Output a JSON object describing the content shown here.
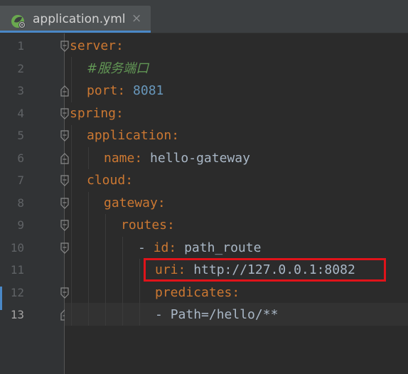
{
  "tab": {
    "title": "application.yml",
    "close_glyph": "×",
    "icon": "spring-leaf-icon"
  },
  "gutter": {
    "line_numbers": [
      "1",
      "2",
      "3",
      "4",
      "5",
      "6",
      "7",
      "8",
      "9",
      "10",
      "11",
      "12",
      "13"
    ],
    "current_line": "13"
  },
  "code": {
    "l1_key": "server",
    "l2_comment": "#服务端口",
    "l3_key": "port",
    "l3_val": "8081",
    "l4_key": "spring",
    "l5_key": "application",
    "l6_key": "name",
    "l6_val": "hello-gateway",
    "l7_key": "cloud",
    "l8_key": "gateway",
    "l9_key": "routes",
    "l10_dash": "- ",
    "l10_key": "id",
    "l10_val": "path_route",
    "l11_key": "uri",
    "l11_val": "http://127.0.0.1:8082",
    "l12_key": "predicates",
    "l13_dash": "- ",
    "l13_val": "Path=/hello/**",
    "colon": ":"
  },
  "colors": {
    "background": "#2b2b2b",
    "key": "#cc7832",
    "number": "#6897bb",
    "comment": "#629755",
    "text": "#a9b7c6",
    "highlight_box": "#e0131a"
  }
}
